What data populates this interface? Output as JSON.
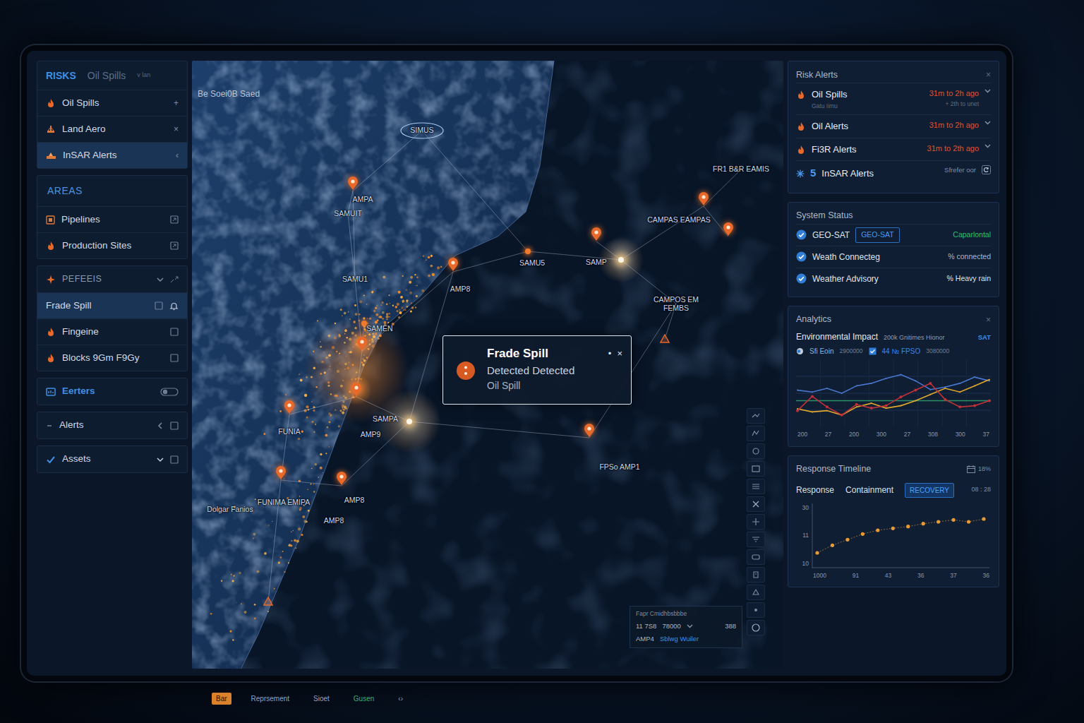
{
  "sidebar": {
    "tabs": [
      {
        "label": "RISKS",
        "selected": true
      },
      {
        "label": "Oil Spills",
        "selected": false
      }
    ],
    "tab_hint": "v  lan",
    "risk_items": [
      {
        "label": "Oil Spills",
        "action": "+",
        "selected": false
      },
      {
        "label": "Land Aero",
        "action": "×",
        "selected": false
      },
      {
        "label": "InSAR Alerts",
        "action": "‹",
        "selected": true
      }
    ],
    "areas": {
      "title": "AREAS",
      "items": [
        {
          "label": "Pipelines"
        },
        {
          "label": "Production Sites"
        }
      ]
    },
    "group": {
      "title": "PEFEEIS",
      "expanded": true,
      "items": [
        {
          "label": "Frade Spill",
          "selected": true
        },
        {
          "label": "Fingeine",
          "selected": false
        },
        {
          "label": "Blocks 9Gm F9Gy",
          "selected": false
        }
      ]
    },
    "sections": [
      {
        "label": "Eerters",
        "kind": "link"
      },
      {
        "label": "Alerts",
        "kind": "collapsed"
      },
      {
        "label": "Assets",
        "kind": "dropdown"
      }
    ]
  },
  "map": {
    "corner_label": "Be Soei0B Saed",
    "nodes": [
      {
        "label": "AMPA",
        "kind": "marker"
      },
      {
        "label": "SAMUIT",
        "kind": "label"
      },
      {
        "label": "SIMUS",
        "kind": "ring"
      },
      {
        "label": "SAMU1",
        "kind": "label"
      },
      {
        "label": "AMP8",
        "kind": "marker"
      },
      {
        "label": "SAMEN",
        "kind": "glow"
      },
      {
        "label": "SAMPA",
        "kind": "light"
      },
      {
        "label": "AMP9",
        "kind": "glow"
      },
      {
        "label": "SAMU5",
        "kind": "dot"
      },
      {
        "label": "SAMP",
        "kind": "light"
      },
      {
        "label": "CAMPAS EAMPAS",
        "kind": "marker"
      },
      {
        "kind": "marker"
      },
      {
        "label": "FR1 B&R EAMIS",
        "kind": "label"
      },
      {
        "label": "CAMPOS EM FEMBS",
        "kind": "label"
      },
      {
        "kind": "alert"
      },
      {
        "label": "FPSo AMP1",
        "kind": "marker"
      },
      {
        "label": "FUNIA",
        "kind": "marker"
      },
      {
        "label": "FUNIMA EMIPA",
        "kind": "marker"
      },
      {
        "label": "Dolgar Fanios",
        "kind": "label"
      },
      {
        "label": "AMP8",
        "kind": "marker"
      },
      {
        "label": "AMP8",
        "kind": "label"
      },
      {
        "kind": "alert"
      },
      {
        "kind": "marker"
      },
      {
        "kind": "dot"
      }
    ],
    "popup": {
      "title": "Frade Spill",
      "status": "Detected Detected",
      "type": "Oil Spill",
      "pin": "•",
      "close": "×"
    },
    "info_box": {
      "title": "Fapr Cmidhbsbbbe",
      "value_a": "11 7S8",
      "value_b": "78000",
      "value_c": "388",
      "asset": "AMP4",
      "link": "Sblwg Wuiler"
    }
  },
  "right": {
    "risk_alerts": {
      "title": "Risk Alerts",
      "close": "×",
      "items": [
        {
          "label": "Oil Spills",
          "kind": "alert",
          "time": "31m to 2h ago",
          "note": "Gatu  Iimu",
          "time_note": "+ 2th to unet"
        },
        {
          "label": "Oil Alerts",
          "kind": "alert",
          "time": "31m to 2h ago"
        },
        {
          "label": "Fi3R Alerts",
          "kind": "alert",
          "time": "31m to 2th ago"
        },
        {
          "label": "InSAR Alerts",
          "kind": "info",
          "count": "5",
          "time": "Sfrefer oor"
        }
      ]
    },
    "system_status": {
      "title": "System Status",
      "items": [
        {
          "label": "GEO-SAT",
          "badge": "GEO-SAT",
          "value": "Caparlontal",
          "color": "#2fbf71"
        },
        {
          "label": "Weath Connecteg",
          "value": "% connected",
          "color": "#aab6c6"
        },
        {
          "label": "Weather Advisory",
          "value": "% Heavy rain",
          "color": "#dce4ee"
        }
      ]
    },
    "analytics": {
      "title": "Analytics",
      "close": "×",
      "subtitle": "Environmental Impact",
      "meta": "200k Gnitimes  Hionor",
      "tag": "SAT",
      "legend": [
        {
          "label": "Sfi Eoin",
          "value": "2900000",
          "color": "#8fb0dc"
        },
        {
          "label": "44 № FPSO",
          "value": "3080000",
          "color": "#3b86e0"
        }
      ],
      "x_ticks": [
        "200",
        "27",
        "200",
        "300",
        "27",
        "308",
        "300",
        "37"
      ],
      "reference": {
        "value": 38,
        "color": "#2c8f66"
      },
      "series": [
        {
          "color": "#4a78d0",
          "values": [
            55,
            52,
            58,
            50,
            62,
            66,
            74,
            80,
            70,
            56,
            60,
            66,
            76,
            70
          ]
        },
        {
          "color": "#e0a82e",
          "values": [
            25,
            20,
            22,
            15,
            28,
            34,
            26,
            30,
            38,
            48,
            58,
            52,
            62,
            72
          ]
        },
        {
          "color": "#c0303a",
          "values": [
            22,
            45,
            28,
            15,
            32,
            26,
            30,
            44,
            55,
            66,
            40,
            28,
            30,
            38
          ]
        }
      ]
    },
    "response": {
      "title": "Response Timeline",
      "pct": "18%",
      "tabs": [
        {
          "label": "Response",
          "selected": false
        },
        {
          "label": "Containment",
          "selected": false
        },
        {
          "label": "RECOVERY",
          "selected": true
        }
      ],
      "clock": "08 : 28",
      "y_ticks": [
        "30",
        "11",
        "10"
      ],
      "x_ticks": [
        "1000",
        "91",
        "43",
        "36",
        "37",
        "36"
      ],
      "values": [
        12,
        20,
        26,
        32,
        36,
        38,
        40,
        43,
        45,
        47,
        45,
        48
      ]
    }
  },
  "taskbar": [
    {
      "label": "Bar",
      "color": "#d9822b"
    },
    {
      "label": "Reprsement",
      "color": "#8fa3bf"
    },
    {
      "label": "Sioet",
      "color": "#8fa3bf"
    },
    {
      "label": "Gusen",
      "color": "#35b07a"
    },
    {
      "label": "‹›",
      "color": "#8fa3bf"
    }
  ]
}
